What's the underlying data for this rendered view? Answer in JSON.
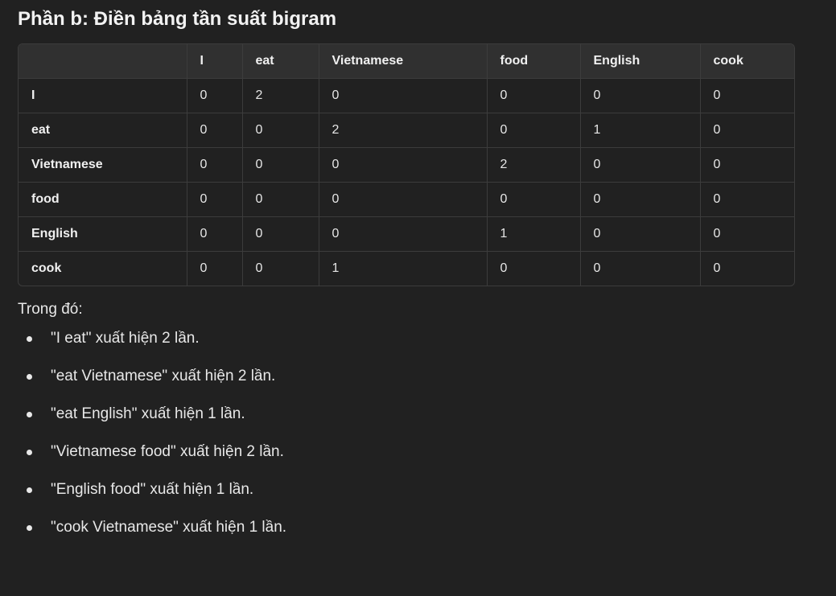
{
  "heading": "Phần b: Điền bảng tần suất bigram",
  "table": {
    "columns": [
      "",
      "I",
      "eat",
      "Vietnamese",
      "food",
      "English",
      "cook"
    ],
    "rows": [
      {
        "label": "I",
        "values": [
          "0",
          "2",
          "0",
          "0",
          "0",
          "0"
        ]
      },
      {
        "label": "eat",
        "values": [
          "0",
          "0",
          "2",
          "0",
          "1",
          "0"
        ]
      },
      {
        "label": "Vietnamese",
        "values": [
          "0",
          "0",
          "0",
          "2",
          "0",
          "0"
        ]
      },
      {
        "label": "food",
        "values": [
          "0",
          "0",
          "0",
          "0",
          "0",
          "0"
        ]
      },
      {
        "label": "English",
        "values": [
          "0",
          "0",
          "0",
          "1",
          "0",
          "0"
        ]
      },
      {
        "label": "cook",
        "values": [
          "0",
          "0",
          "1",
          "0",
          "0",
          "0"
        ]
      }
    ]
  },
  "intro": "Trong đó:",
  "bullets": [
    "\"I eat\" xuất hiện 2 lần.",
    "\"eat Vietnamese\" xuất hiện 2 lần.",
    "\"eat English\" xuất hiện 1 lần.",
    "\"Vietnamese food\" xuất hiện 2 lần.",
    "\"English food\" xuất hiện 1 lần.",
    "\"cook Vietnamese\" xuất hiện 1 lần."
  ]
}
